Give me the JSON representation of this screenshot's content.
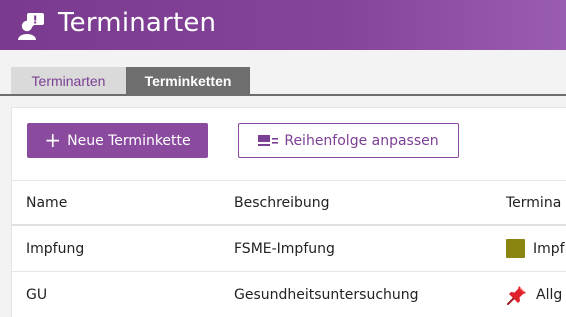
{
  "app": {
    "title": "Terminarten",
    "icon": "person-with-chat-bubble-icon",
    "header_color": "#7a3a8e"
  },
  "tabs": [
    {
      "label": "Terminarten",
      "active": false
    },
    {
      "label": "Terminketten",
      "active": true
    }
  ],
  "toolbar": {
    "new_button_label": "Neue Terminkette",
    "new_button_icon": "plus-icon",
    "reorder_button_label": "Reihenfolge anpassen",
    "reorder_button_icon": "reorder-list-icon"
  },
  "table": {
    "columns": [
      "Name",
      "Beschreibung",
      "Termina"
    ],
    "rows": [
      {
        "name": "Impfung",
        "description": "FSME-Impfung",
        "type_label": "Impf",
        "type_icon": "color-swatch",
        "type_color": "#8a8410"
      },
      {
        "name": "GU",
        "description": "Gesundheitsuntersuchung",
        "type_label": "Allg",
        "type_icon": "pushpin-icon",
        "type_color": "#e0202a"
      }
    ]
  },
  "colors": {
    "accent": "#8a4a9e",
    "tab_active_bg": "#6e6e6e",
    "tab_inactive_bg": "#dadada"
  }
}
